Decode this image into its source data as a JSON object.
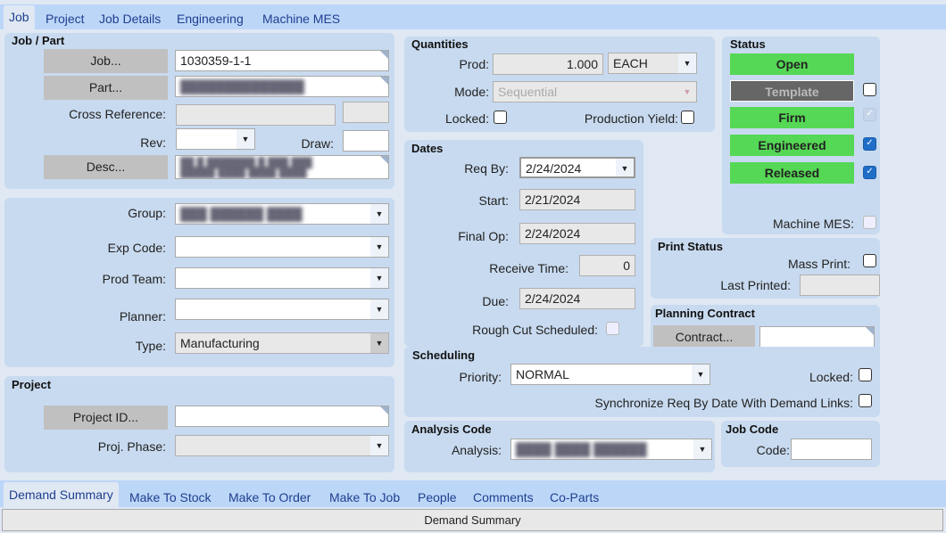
{
  "tabs": [
    "Job",
    "Project",
    "Job Details",
    "Engineering",
    "Machine MES"
  ],
  "job_part": {
    "title": "Job / Part",
    "job_btn": "Job...",
    "job_value": "1030359-1-1",
    "part_btn": "Part...",
    "cross_ref_label": "Cross Reference:",
    "rev_label": "Rev:",
    "draw_label": "Draw:",
    "desc_btn": "Desc..."
  },
  "classification": {
    "group_label": "Group:",
    "exp_code_label": "Exp Code:",
    "prod_team_label": "Prod Team:",
    "planner_label": "Planner:",
    "type_label": "Type:",
    "type_value": "Manufacturing"
  },
  "project": {
    "title": "Project",
    "project_id_btn": "Project ID...",
    "phase_label": "Proj. Phase:"
  },
  "quantities": {
    "title": "Quantities",
    "prod_label": "Prod:",
    "prod_value": "1.000",
    "uom": "EACH",
    "mode_label": "Mode:",
    "mode_value": "Sequential",
    "locked_label": "Locked:",
    "yield_label": "Production Yield:"
  },
  "dates": {
    "title": "Dates",
    "req_by_label": "Req By:",
    "req_by": "2/24/2024",
    "start_label": "Start:",
    "start": "2/21/2024",
    "final_op_label": "Final Op:",
    "final_op": "2/24/2024",
    "receive_label": "Receive Time:",
    "receive": "0",
    "due_label": "Due:",
    "due": "2/24/2024",
    "rough_cut_label": "Rough Cut Scheduled:"
  },
  "status": {
    "title": "Status",
    "open": "Open",
    "template": "Template",
    "firm": "Firm",
    "engineered": "Engineered",
    "released": "Released",
    "machine_mes_label": "Machine MES:"
  },
  "print_status": {
    "title": "Print Status",
    "mass_print_label": "Mass Print:",
    "last_printed_label": "Last Printed:"
  },
  "planning": {
    "title": "Planning Contract",
    "contract_btn": "Contract..."
  },
  "scheduling": {
    "title": "Scheduling",
    "priority_label": "Priority:",
    "priority": "NORMAL",
    "locked_label": "Locked:",
    "sync_label": "Synchronize Req By Date With Demand Links:"
  },
  "analysis": {
    "title": "Analysis Code",
    "analysis_label": "Analysis:"
  },
  "job_code": {
    "title": "Job Code",
    "code_label": "Code:"
  },
  "bottom_tabs": [
    "Demand Summary",
    "Make To Stock",
    "Make To Order",
    "Make To Job",
    "People",
    "Comments",
    "Co-Parts"
  ],
  "bottom_header": "Demand Summary"
}
